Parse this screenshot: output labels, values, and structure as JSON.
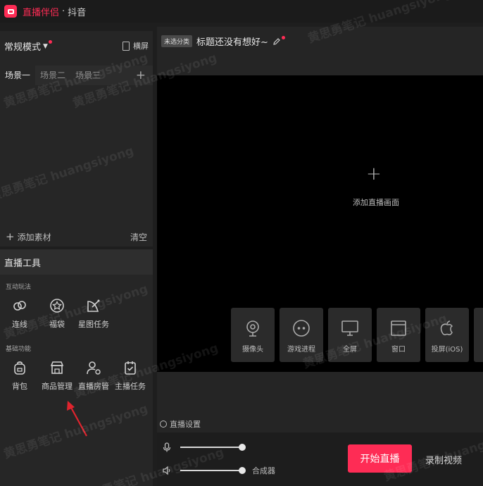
{
  "titlebar": {
    "app_name": "直播伴侣",
    "separator": "·",
    "platform": "抖音"
  },
  "mode": {
    "label": "常规模式",
    "caret": "▼",
    "landscape_label": "横屏"
  },
  "scenes": {
    "tabs": [
      "场景一",
      "场景二",
      "场景三"
    ],
    "add_symbol": "+"
  },
  "materials": {
    "add_symbol": "+",
    "add_label": "添加素材",
    "clear_label": "清空"
  },
  "tools": {
    "title": "直播工具",
    "section1": "互动玩法",
    "section1_items": [
      "连线",
      "福袋",
      "星图任务"
    ],
    "section2": "基础功能",
    "section2_items": [
      "背包",
      "商品管理",
      "直播房管",
      "主播任务"
    ]
  },
  "live": {
    "category_badge": "未选分类",
    "title": "标题还没有想好~",
    "preview_add_symbol": "+",
    "preview_add_label": "添加直播画面",
    "sources": [
      "摄像头",
      "游戏进程",
      "全屏",
      "窗口",
      "投屏(iOS)"
    ],
    "settings_label": "直播设置",
    "mixer_label": "合成器",
    "start_label": "开始直播",
    "record_label": "录制视频"
  },
  "watermark": {
    "text": "黄思勇笔记 huangsiyong"
  },
  "colors": {
    "accent": "#fe2c55",
    "panel": "#262626",
    "preview": "#000000"
  }
}
